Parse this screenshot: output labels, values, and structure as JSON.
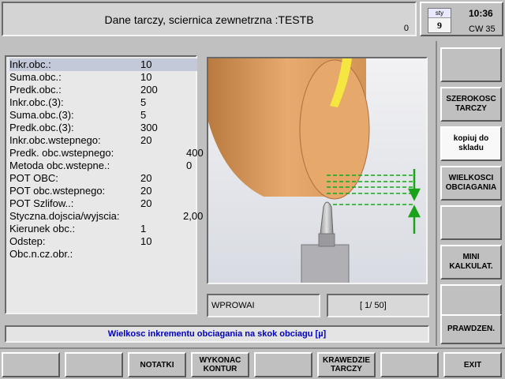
{
  "header": {
    "title": "Dane tarczy, sciernica zewnetrzna :TESTB",
    "counter": "0",
    "calendar_month": "sty",
    "calendar_day": "9",
    "time": "10:36",
    "week": "CW 35"
  },
  "params": [
    {
      "label": "Inkr.obc.:",
      "value": "10"
    },
    {
      "label": "Suma.obc.:",
      "value": "10"
    },
    {
      "label": "Predk.obc.:",
      "value": "200"
    },
    {
      "label": "Inkr.obc.(3):",
      "value": "5"
    },
    {
      "label": "Suma.obc.(3):",
      "value": "5"
    },
    {
      "label": "Predk.obc.(3):",
      "value": "300"
    },
    {
      "label": "Inkr.obc.wstepnego:",
      "value": "20"
    },
    {
      "label": "Predk. obc.wstepnego:",
      "value": "400"
    },
    {
      "label": " Metoda obc.wstepne.:",
      "value": "0"
    },
    {
      "label": "POT OBC:",
      "value": "20"
    },
    {
      "label": "POT obc.wstepnego:",
      "value": "20"
    },
    {
      "label": "POT Szlifow..:",
      "value": "20"
    },
    {
      "label": "Styczna.dojscia/wyjscia:",
      "value": "2,00"
    },
    {
      "label": "Kierunek obc.:",
      "value": "1"
    },
    {
      "label": "Odstep:",
      "value": "10"
    },
    {
      "label": "Obc.n.cz.obr.:",
      "value": ""
    }
  ],
  "status": {
    "mode": "WPROWAI",
    "page": "[ 1/ 50]"
  },
  "hint": "Wielkosc inkrementu obciagania na skok obciagu [µ]",
  "side_buttons": [
    "",
    "SZEROKOSC\nTARCZY",
    "kopiuj do\nskladu",
    "WIELKOSCI\nOBCIAGANIA",
    "",
    "MINI\nKALKULAT.",
    "",
    "PRAWDZEN."
  ],
  "bottom_buttons": [
    "",
    "",
    "NOTATKI",
    "WYKONAC\nKONTUR",
    "",
    "KRAWEDZIE\nTARCZY",
    "",
    "EXIT"
  ],
  "colors": {
    "wheel": "#e0a56a",
    "dressing_lines": "#1aa31a",
    "hint_text": "#0000bb",
    "selected_row": "#c4c9da"
  }
}
